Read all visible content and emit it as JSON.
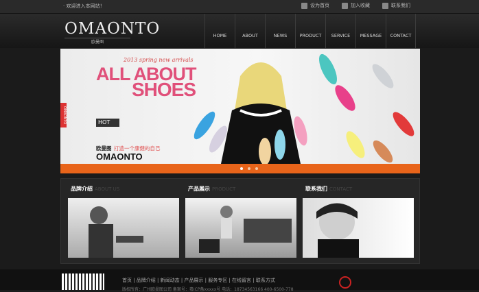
{
  "topbar": {
    "welcome": "· 欢迎进入本网站！",
    "links": [
      {
        "icon": "home-icon",
        "label": "设为首页"
      },
      {
        "icon": "bookmark-icon",
        "label": "加入收藏"
      },
      {
        "icon": "contact-icon",
        "label": "联系我们"
      }
    ]
  },
  "logo": {
    "main": "OMAONTO",
    "sub": "欧曼图"
  },
  "nav": [
    "HOME",
    "ABOUT",
    "NEWS",
    "PRODUCT",
    "SERVICE",
    "MESSAGE",
    "CONTACT"
  ],
  "banner": {
    "script": "2013 spring new arrivals",
    "headline1": "ALL ABOUT",
    "headline2": "SHOES",
    "hot": "HOT",
    "brand_cn": "欧曼图",
    "slogan": "打造一个康健的自己",
    "brand_en": "OMAONTO",
    "side_tag": "OMAONTO",
    "slides": 3,
    "active_slide": 1
  },
  "sections": [
    {
      "title": "品牌介绍",
      "en": "ABOUT US"
    },
    {
      "title": "产品展示",
      "en": "PRODUCT"
    },
    {
      "title": "联系我们",
      "en": "CONTACT"
    }
  ],
  "footer": {
    "links": "首页 | 品牌介绍 | 新闻动态 | 产品展示 | 服务专区 | 在线留言 | 联系方式",
    "line2": "版权所有：广州欧曼图公司 备案号：粤ICP备xxxxx号 电话：18734563166 400-6500-778"
  },
  "colors": {
    "accent": "#e8641a",
    "headline": "#e0507a"
  }
}
